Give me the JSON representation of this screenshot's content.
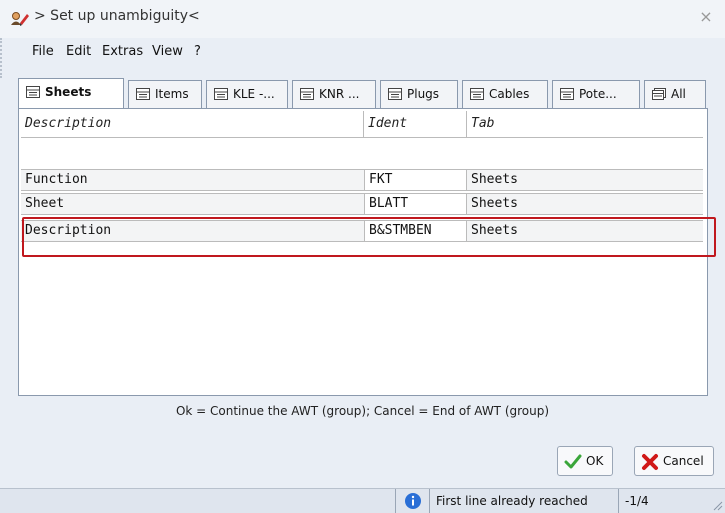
{
  "window": {
    "title": "> Set up unambiguity<",
    "close_glyph": "×"
  },
  "menu": {
    "items": [
      "File",
      "Edit",
      "Extras",
      "View",
      "?"
    ]
  },
  "tabs": [
    {
      "label": "Sheets",
      "active": true
    },
    {
      "label": "Items",
      "active": false
    },
    {
      "label": "KLE -...",
      "active": false
    },
    {
      "label": "KNR ...",
      "active": false
    },
    {
      "label": "Plugs",
      "active": false
    },
    {
      "label": "Cables",
      "active": false
    },
    {
      "label": "Pote...",
      "active": false
    },
    {
      "label": "All",
      "active": false
    }
  ],
  "grid": {
    "columns": [
      "Description",
      "Ident",
      "Tab"
    ],
    "rows": [
      {
        "description": "Function",
        "ident": "FKT",
        "tab": "Sheets"
      },
      {
        "description": "Sheet",
        "ident": "BLATT",
        "tab": "Sheets"
      },
      {
        "description": "Description",
        "ident": "B&STMBEN",
        "tab": "Sheets"
      }
    ],
    "highlight_color": "#c0181e"
  },
  "hint": "Ok = Continue the AWT (group); Cancel = End of AWT (group)",
  "buttons": {
    "ok": "OK",
    "cancel": "Cancel"
  },
  "status": {
    "message": "First line already reached",
    "counter": "-1/4"
  },
  "icons": {
    "title": "user-edit-icon",
    "tab": "table-icon",
    "all_tab": "multi-table-icon",
    "ok": "checkmark-icon",
    "cancel": "red-x-icon",
    "info": "info-icon"
  }
}
